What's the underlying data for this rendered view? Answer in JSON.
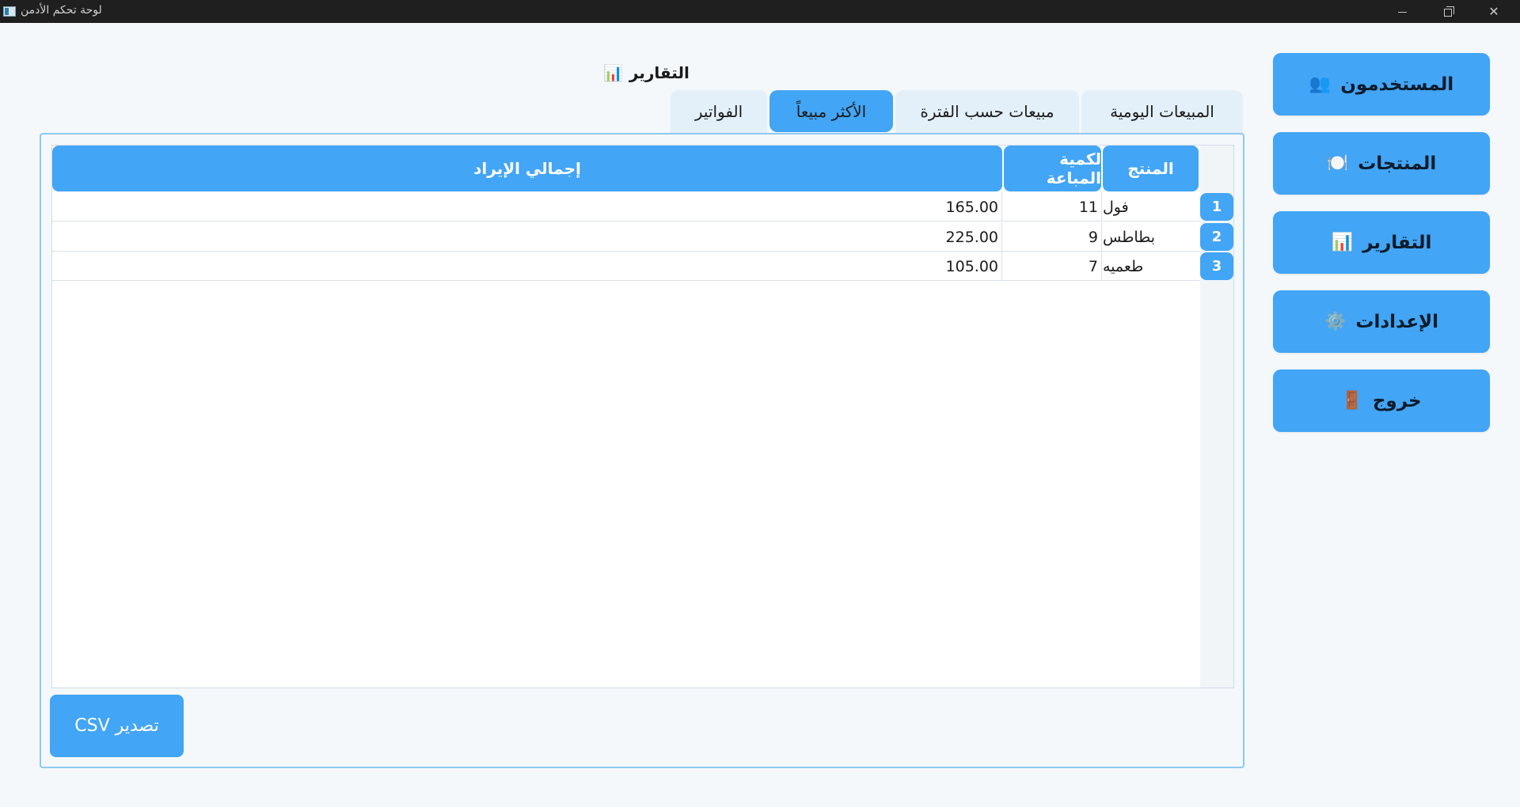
{
  "window": {
    "title": "لوحة تحكم الأدمن",
    "minimize_glyph": "",
    "maximize_glyph": "",
    "close_glyph": "✕"
  },
  "sidebar": {
    "items": [
      {
        "label": "المستخدمون",
        "icon": "👥",
        "icon_name": "users-icon"
      },
      {
        "label": "المنتجات",
        "icon": "🍽️",
        "icon_name": "plate-icon"
      },
      {
        "label": "التقارير",
        "icon": "📊",
        "icon_name": "bar-chart-icon"
      },
      {
        "label": "الإعدادات",
        "icon": "⚙️",
        "icon_name": "gear-icon"
      },
      {
        "label": "خروج",
        "icon": "🚪",
        "icon_name": "door-icon"
      }
    ]
  },
  "header": {
    "title": "التقارير",
    "icon": "📊"
  },
  "tabs": [
    {
      "label": "المبيعات اليومية",
      "active": false
    },
    {
      "label": "مبيعات حسب الفترة",
      "active": false
    },
    {
      "label": "الأكثر مبيعاً",
      "active": true
    },
    {
      "label": "الفواتير",
      "active": false
    }
  ],
  "table": {
    "columns": {
      "product": "المنتج",
      "quantity": "لكمية المباعة",
      "revenue": "إجمالي الإيراد"
    },
    "rows": [
      {
        "num": "1",
        "product": "فول",
        "quantity": "11",
        "revenue": "165.00"
      },
      {
        "num": "2",
        "product": "بطاطس",
        "quantity": "9",
        "revenue": "225.00"
      },
      {
        "num": "3",
        "product": "طعميه",
        "quantity": "7",
        "revenue": "105.00"
      }
    ]
  },
  "export": {
    "label": "تصدير CSV"
  },
  "colors": {
    "accent": "#42a5f5",
    "tab_inactive": "#e3f0fa",
    "background": "#f4f8fb",
    "titlebar": "#1f1f1f"
  }
}
